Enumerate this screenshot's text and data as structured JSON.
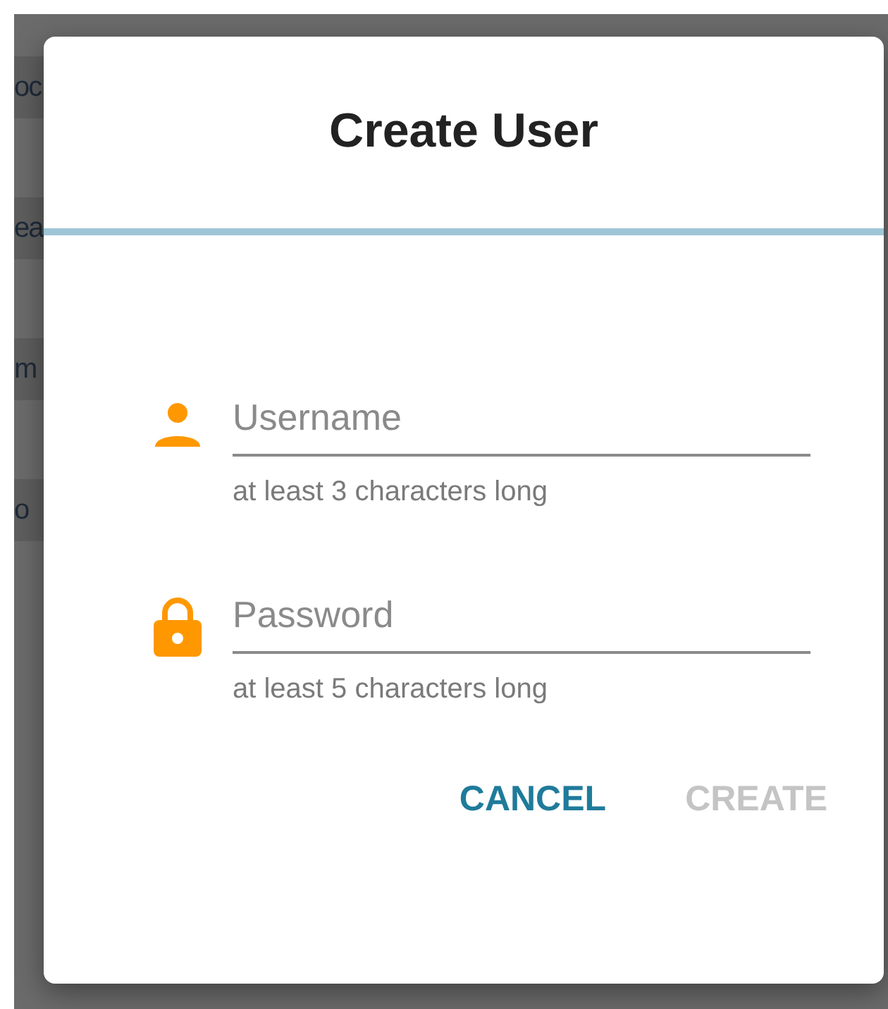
{
  "background_list": {
    "items": [
      "oc",
      "ea",
      "m",
      "o"
    ]
  },
  "dialog": {
    "title": "Create User",
    "fields": [
      {
        "kind": "username",
        "placeholder": "Username",
        "hint": "at least 3 characters long"
      },
      {
        "kind": "password",
        "placeholder": "Password",
        "hint": "at least 5 characters long"
      }
    ],
    "buttons": [
      {
        "label": "CANCEL",
        "disabled": false
      },
      {
        "label": "CREATE",
        "disabled": true
      }
    ]
  }
}
